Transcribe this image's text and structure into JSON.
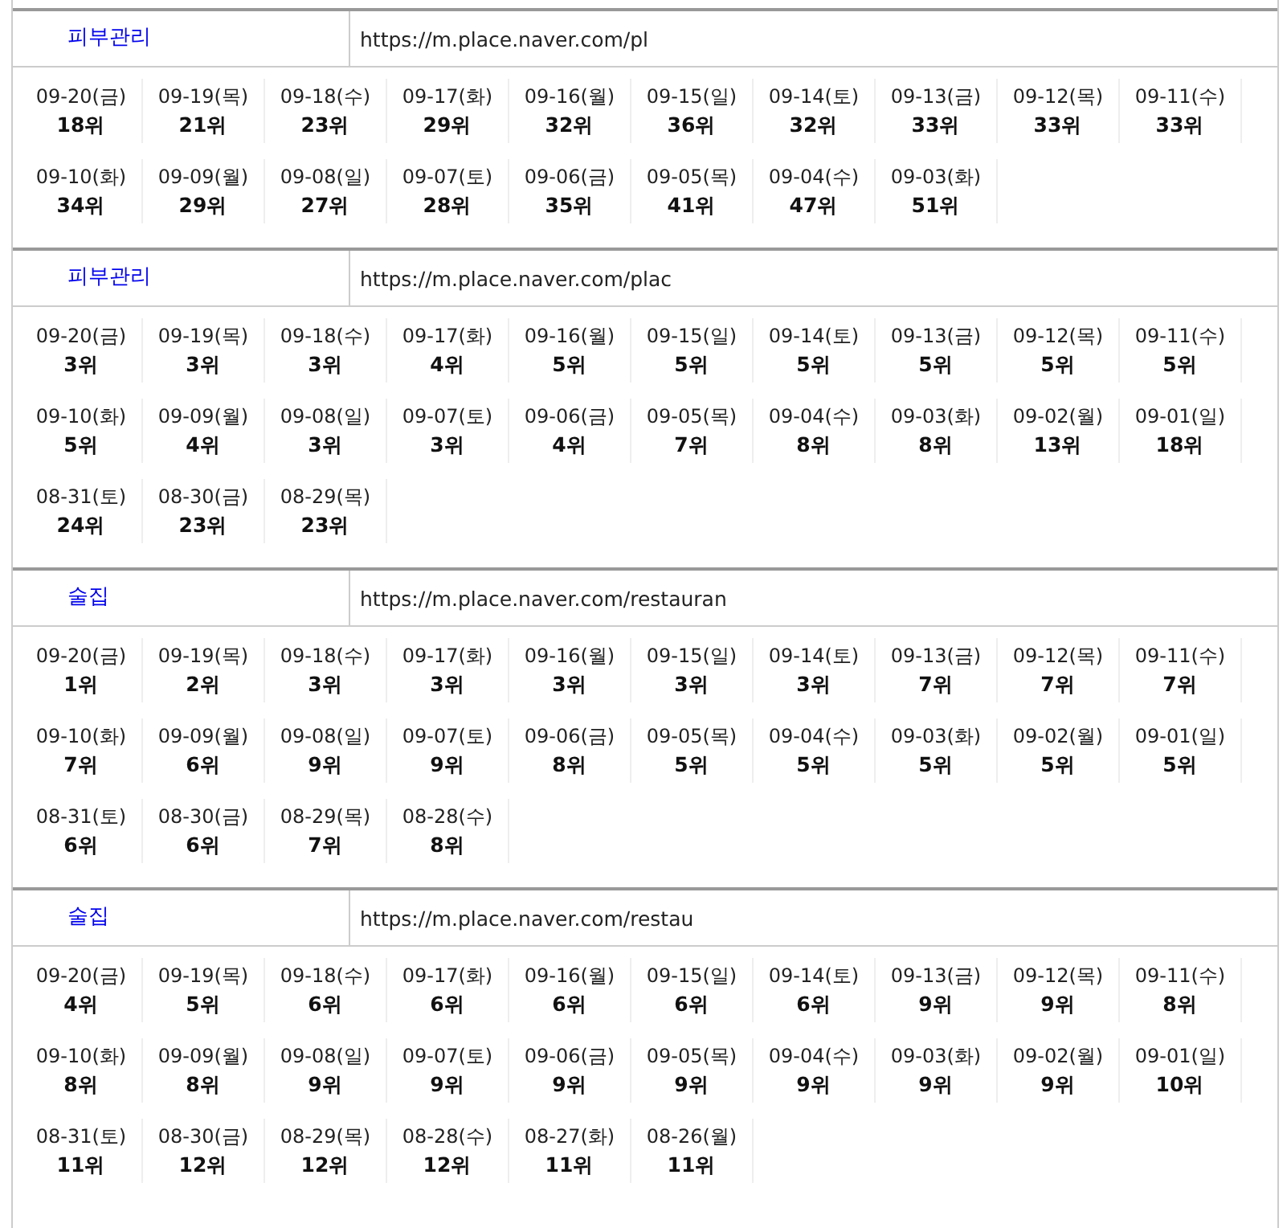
{
  "sections": [
    {
      "keyword": "피부관리",
      "url": "https://m.place.naver.com/pl",
      "ranks": [
        {
          "date": "09-20(금)",
          "rank": "18위"
        },
        {
          "date": "09-19(목)",
          "rank": "21위"
        },
        {
          "date": "09-18(수)",
          "rank": "23위"
        },
        {
          "date": "09-17(화)",
          "rank": "29위"
        },
        {
          "date": "09-16(월)",
          "rank": "32위"
        },
        {
          "date": "09-15(일)",
          "rank": "36위"
        },
        {
          "date": "09-14(토)",
          "rank": "32위"
        },
        {
          "date": "09-13(금)",
          "rank": "33위"
        },
        {
          "date": "09-12(목)",
          "rank": "33위"
        },
        {
          "date": "09-11(수)",
          "rank": "33위"
        },
        {
          "date": "09-10(화)",
          "rank": "34위"
        },
        {
          "date": "09-09(월)",
          "rank": "29위"
        },
        {
          "date": "09-08(일)",
          "rank": "27위"
        },
        {
          "date": "09-07(토)",
          "rank": "28위"
        },
        {
          "date": "09-06(금)",
          "rank": "35위"
        },
        {
          "date": "09-05(목)",
          "rank": "41위"
        },
        {
          "date": "09-04(수)",
          "rank": "47위"
        },
        {
          "date": "09-03(화)",
          "rank": "51위"
        }
      ]
    },
    {
      "keyword": "피부관리",
      "url": "https://m.place.naver.com/plac",
      "ranks": [
        {
          "date": "09-20(금)",
          "rank": "3위"
        },
        {
          "date": "09-19(목)",
          "rank": "3위"
        },
        {
          "date": "09-18(수)",
          "rank": "3위"
        },
        {
          "date": "09-17(화)",
          "rank": "4위"
        },
        {
          "date": "09-16(월)",
          "rank": "5위"
        },
        {
          "date": "09-15(일)",
          "rank": "5위"
        },
        {
          "date": "09-14(토)",
          "rank": "5위"
        },
        {
          "date": "09-13(금)",
          "rank": "5위"
        },
        {
          "date": "09-12(목)",
          "rank": "5위"
        },
        {
          "date": "09-11(수)",
          "rank": "5위"
        },
        {
          "date": "09-10(화)",
          "rank": "5위"
        },
        {
          "date": "09-09(월)",
          "rank": "4위"
        },
        {
          "date": "09-08(일)",
          "rank": "3위"
        },
        {
          "date": "09-07(토)",
          "rank": "3위"
        },
        {
          "date": "09-06(금)",
          "rank": "4위"
        },
        {
          "date": "09-05(목)",
          "rank": "7위"
        },
        {
          "date": "09-04(수)",
          "rank": "8위"
        },
        {
          "date": "09-03(화)",
          "rank": "8위"
        },
        {
          "date": "09-02(월)",
          "rank": "13위"
        },
        {
          "date": "09-01(일)",
          "rank": "18위"
        },
        {
          "date": "08-31(토)",
          "rank": "24위"
        },
        {
          "date": "08-30(금)",
          "rank": "23위"
        },
        {
          "date": "08-29(목)",
          "rank": "23위"
        }
      ]
    },
    {
      "keyword": "술집",
      "url": "https://m.place.naver.com/restauran",
      "ranks": [
        {
          "date": "09-20(금)",
          "rank": "1위"
        },
        {
          "date": "09-19(목)",
          "rank": "2위"
        },
        {
          "date": "09-18(수)",
          "rank": "3위"
        },
        {
          "date": "09-17(화)",
          "rank": "3위"
        },
        {
          "date": "09-16(월)",
          "rank": "3위"
        },
        {
          "date": "09-15(일)",
          "rank": "3위"
        },
        {
          "date": "09-14(토)",
          "rank": "3위"
        },
        {
          "date": "09-13(금)",
          "rank": "7위"
        },
        {
          "date": "09-12(목)",
          "rank": "7위"
        },
        {
          "date": "09-11(수)",
          "rank": "7위"
        },
        {
          "date": "09-10(화)",
          "rank": "7위"
        },
        {
          "date": "09-09(월)",
          "rank": "6위"
        },
        {
          "date": "09-08(일)",
          "rank": "9위"
        },
        {
          "date": "09-07(토)",
          "rank": "9위"
        },
        {
          "date": "09-06(금)",
          "rank": "8위"
        },
        {
          "date": "09-05(목)",
          "rank": "5위"
        },
        {
          "date": "09-04(수)",
          "rank": "5위"
        },
        {
          "date": "09-03(화)",
          "rank": "5위"
        },
        {
          "date": "09-02(월)",
          "rank": "5위"
        },
        {
          "date": "09-01(일)",
          "rank": "5위"
        },
        {
          "date": "08-31(토)",
          "rank": "6위"
        },
        {
          "date": "08-30(금)",
          "rank": "6위"
        },
        {
          "date": "08-29(목)",
          "rank": "7위"
        },
        {
          "date": "08-28(수)",
          "rank": "8위"
        }
      ]
    },
    {
      "keyword": "술집",
      "url": "https://m.place.naver.com/restau",
      "ranks": [
        {
          "date": "09-20(금)",
          "rank": "4위"
        },
        {
          "date": "09-19(목)",
          "rank": "5위"
        },
        {
          "date": "09-18(수)",
          "rank": "6위"
        },
        {
          "date": "09-17(화)",
          "rank": "6위"
        },
        {
          "date": "09-16(월)",
          "rank": "6위"
        },
        {
          "date": "09-15(일)",
          "rank": "6위"
        },
        {
          "date": "09-14(토)",
          "rank": "6위"
        },
        {
          "date": "09-13(금)",
          "rank": "9위"
        },
        {
          "date": "09-12(목)",
          "rank": "9위"
        },
        {
          "date": "09-11(수)",
          "rank": "8위"
        },
        {
          "date": "09-10(화)",
          "rank": "8위"
        },
        {
          "date": "09-09(월)",
          "rank": "8위"
        },
        {
          "date": "09-08(일)",
          "rank": "9위"
        },
        {
          "date": "09-07(토)",
          "rank": "9위"
        },
        {
          "date": "09-06(금)",
          "rank": "9위"
        },
        {
          "date": "09-05(목)",
          "rank": "9위"
        },
        {
          "date": "09-04(수)",
          "rank": "9위"
        },
        {
          "date": "09-03(화)",
          "rank": "9위"
        },
        {
          "date": "09-02(월)",
          "rank": "9위"
        },
        {
          "date": "09-01(일)",
          "rank": "10위"
        },
        {
          "date": "08-31(토)",
          "rank": "11위"
        },
        {
          "date": "08-30(금)",
          "rank": "12위"
        },
        {
          "date": "08-29(목)",
          "rank": "12위"
        },
        {
          "date": "08-28(수)",
          "rank": "12위"
        },
        {
          "date": "08-27(화)",
          "rank": "11위"
        },
        {
          "date": "08-26(월)",
          "rank": "11위"
        }
      ]
    }
  ]
}
